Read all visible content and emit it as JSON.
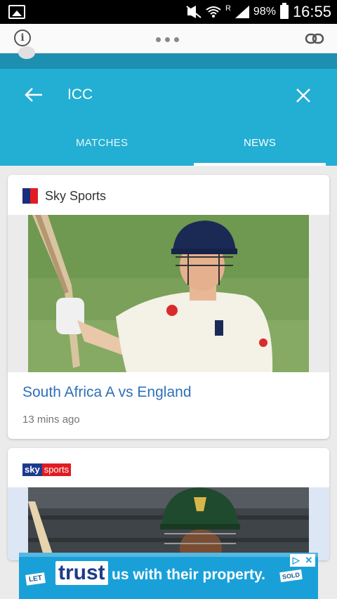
{
  "status_bar": {
    "signal_label": "R",
    "battery": "98%",
    "time": "16:55"
  },
  "browser": {
    "info_glyph": "i"
  },
  "header": {
    "search_query": "ICC",
    "tabs": [
      {
        "label": "MATCHES",
        "active": false
      },
      {
        "label": "NEWS",
        "active": true
      }
    ]
  },
  "cards": [
    {
      "source": "Sky Sports",
      "headline": "South Africa A vs England",
      "time_ago": "13 mins ago"
    },
    {
      "source_logo_sky": "sky",
      "source_logo_sports": "sports"
    }
  ],
  "ad": {
    "let": "LET",
    "trust": "trust",
    "text": "us with their property.",
    "sold": "SOLD",
    "choices_play": "▷",
    "choices_close": "✕"
  },
  "colors": {
    "header": "#23aed3",
    "headline": "#2e70b8",
    "ad": "#1aa0d8"
  }
}
